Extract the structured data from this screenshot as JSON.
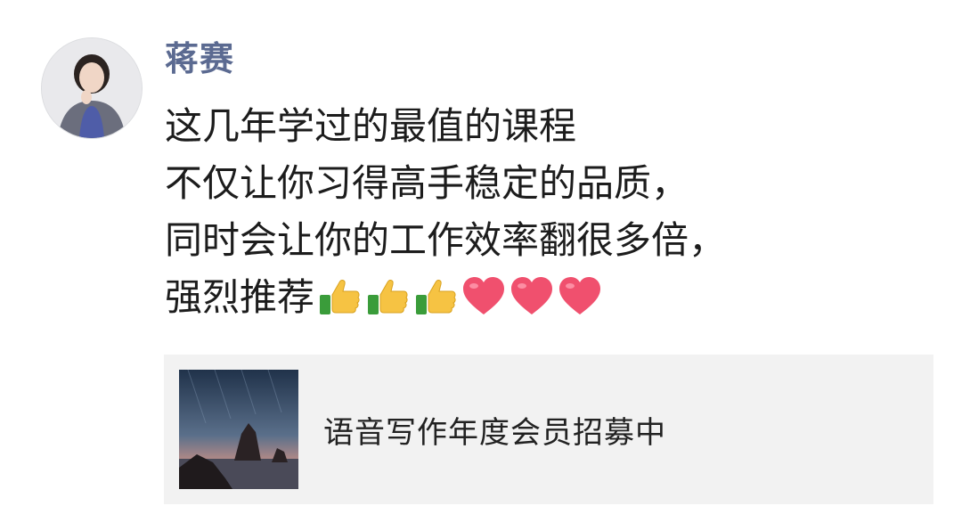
{
  "post": {
    "author": "蒋赛",
    "lines": [
      "这几年学过的最值的课程",
      "不仅让你习得高手稳定的品质，",
      "同时会让你的工作效率翻很多倍，",
      "强烈推荐"
    ],
    "emojis": [
      "thumbs-up",
      "thumbs-up",
      "thumbs-up",
      "heart",
      "heart",
      "heart"
    ]
  },
  "share_card": {
    "title": "语音写作年度会员招募中",
    "thumbnail": "sea-rocks-at-dusk"
  },
  "colors": {
    "author": "#5b6a91",
    "text": "#1c1c1c",
    "card_bg": "#f2f2f2",
    "heart": "#f0506e",
    "thumb": "#f6c343"
  }
}
